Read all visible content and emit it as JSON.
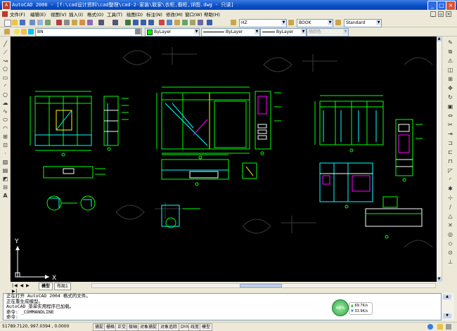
{
  "window": {
    "title": "AutoCAD 2006 - [f:\\cad设计资料\\cad整理\\cad-2-家装\\联家\\衣柜,橱柜,详图.dwg - 只读]"
  },
  "menu": [
    "文件(F)",
    "编辑(E)",
    "视图(V)",
    "插入(I)",
    "格式(O)",
    "工具(T)",
    "绘图(D)",
    "标注(N)",
    "修改(M)",
    "窗口(W)",
    "帮助(H)"
  ],
  "toolbar": {
    "textstyle": "HZ",
    "dimstyle": "BOOK",
    "tablestyle": "Standard",
    "layer": "BN",
    "color": "ByLayer",
    "linetype": "ByLayer",
    "lineweight": "ByLayer",
    "plotstyle": "随颜色"
  },
  "ucs": {
    "x": "X",
    "y": "Y"
  },
  "tabs": [
    "模型",
    "布局1"
  ],
  "command_lines": [
    "正在打开 AutoCAD 2004 格式的文件。",
    "正在重生成模型。",
    "AutoCAD 菜单实用程序已加载。",
    "命令: _COMMANDLINE",
    "命令:"
  ],
  "status": {
    "coords": "51789.7120, 997.0394 , 0.0000",
    "toggles": [
      "捕捉",
      "栅格",
      "正交",
      "极轴",
      "对象捕捉",
      "对象追踪",
      "DYN",
      "线宽",
      "模型"
    ]
  },
  "netmeter": {
    "percent": "48%",
    "up": "69.7K/s",
    "down": "33.9K/s"
  },
  "colors": {
    "canvas": "#000000",
    "green": "#00FF00",
    "cyan": "#00FFFF",
    "yellow": "#FFFF00",
    "magenta": "#FF00FF",
    "titlebar": "#0A4FC7"
  }
}
